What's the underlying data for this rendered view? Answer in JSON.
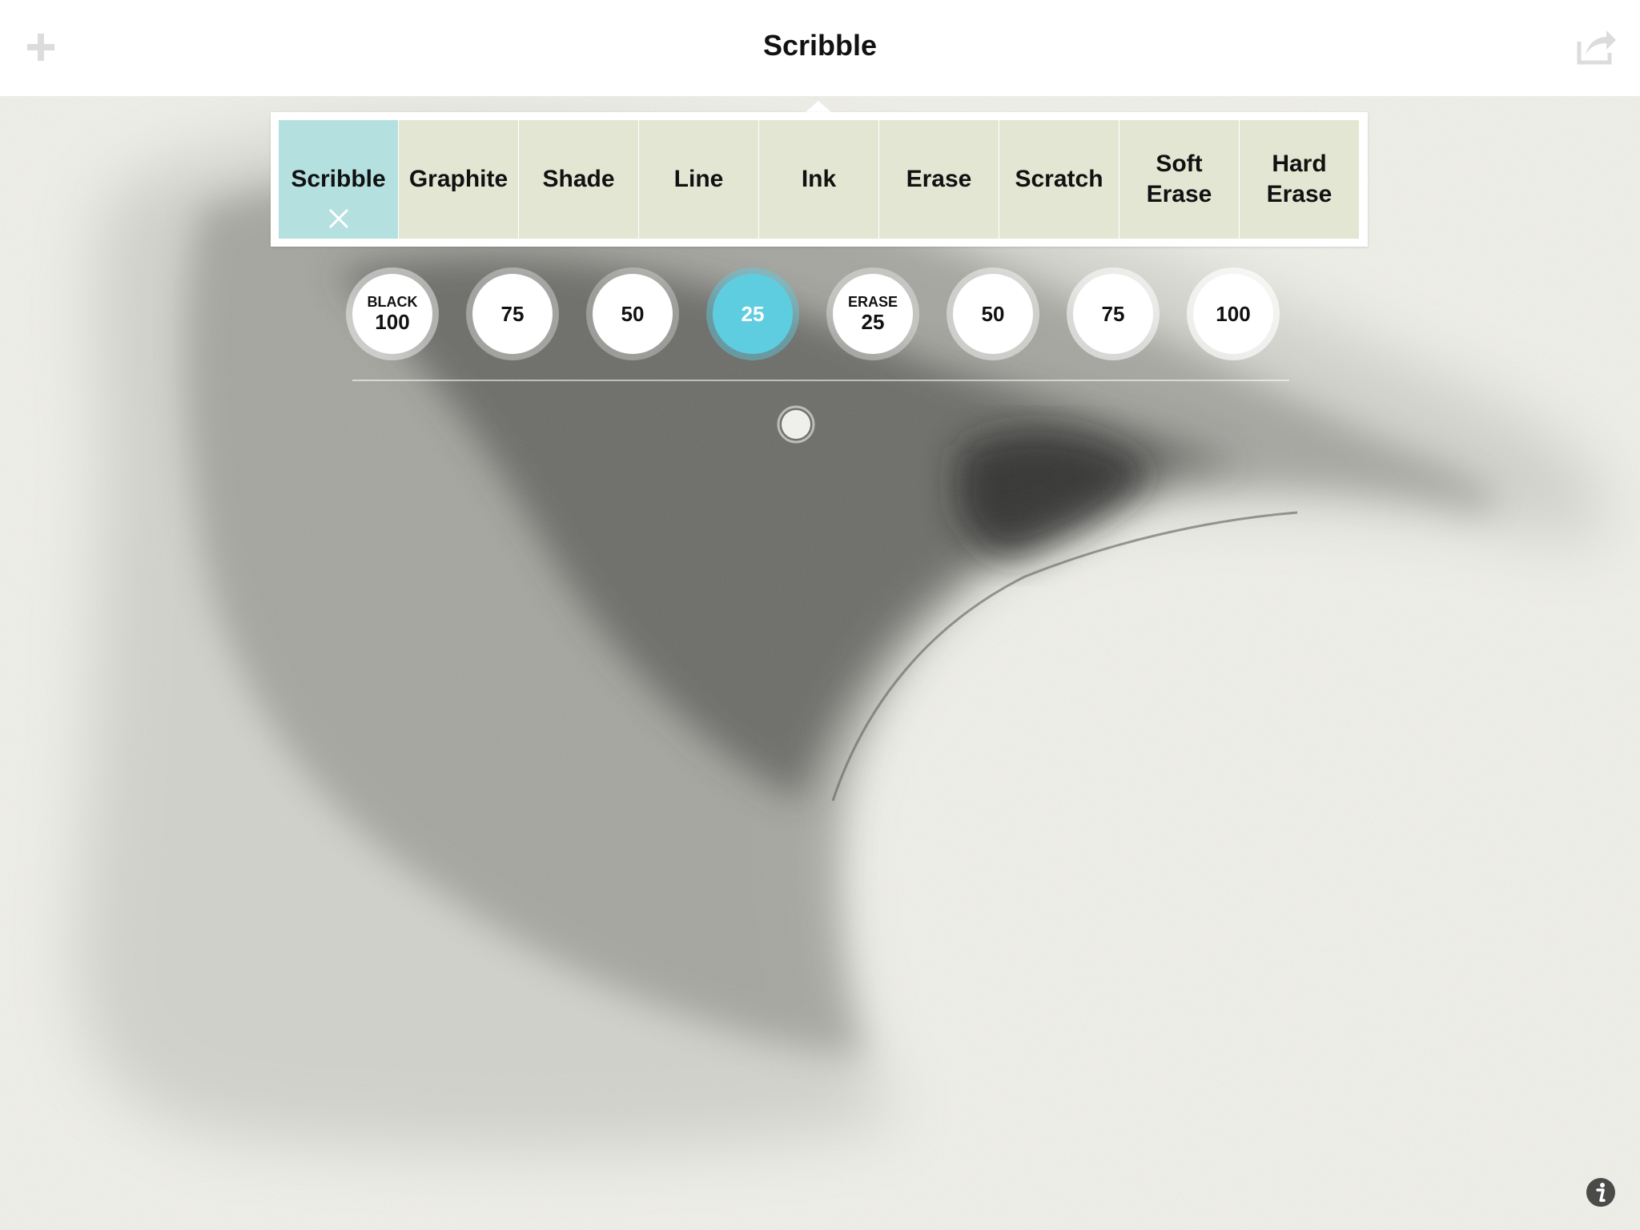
{
  "header": {
    "title": "Scribble",
    "add_icon": "plus-icon",
    "share_icon": "share-icon"
  },
  "brushes": [
    {
      "label": "Scribble",
      "active": true
    },
    {
      "label": "Graphite",
      "active": false
    },
    {
      "label": "Shade",
      "active": false
    },
    {
      "label": "Line",
      "active": false
    },
    {
      "label": "Ink",
      "active": false
    },
    {
      "label": "Erase",
      "active": false
    },
    {
      "label": "Scratch",
      "active": false
    },
    {
      "label": "Soft\nErase",
      "active": false
    },
    {
      "label": "Hard\nErase",
      "active": false
    }
  ],
  "opacity_dots": [
    {
      "top": "BLACK",
      "value": "100"
    },
    {
      "top": "",
      "value": "75"
    },
    {
      "top": "",
      "value": "50"
    },
    {
      "top": "",
      "value": "25",
      "selected": true
    },
    {
      "top": "ERASE",
      "value": "25"
    },
    {
      "top": "",
      "value": "50"
    },
    {
      "top": "",
      "value": "75"
    },
    {
      "top": "",
      "value": "100"
    }
  ],
  "colors": {
    "active_tab": "#b5e0e0",
    "tab": "#e4e6d4",
    "selected_dot": "#5fcde0",
    "paper": "#f1f1ea"
  },
  "info_icon": "info-icon"
}
